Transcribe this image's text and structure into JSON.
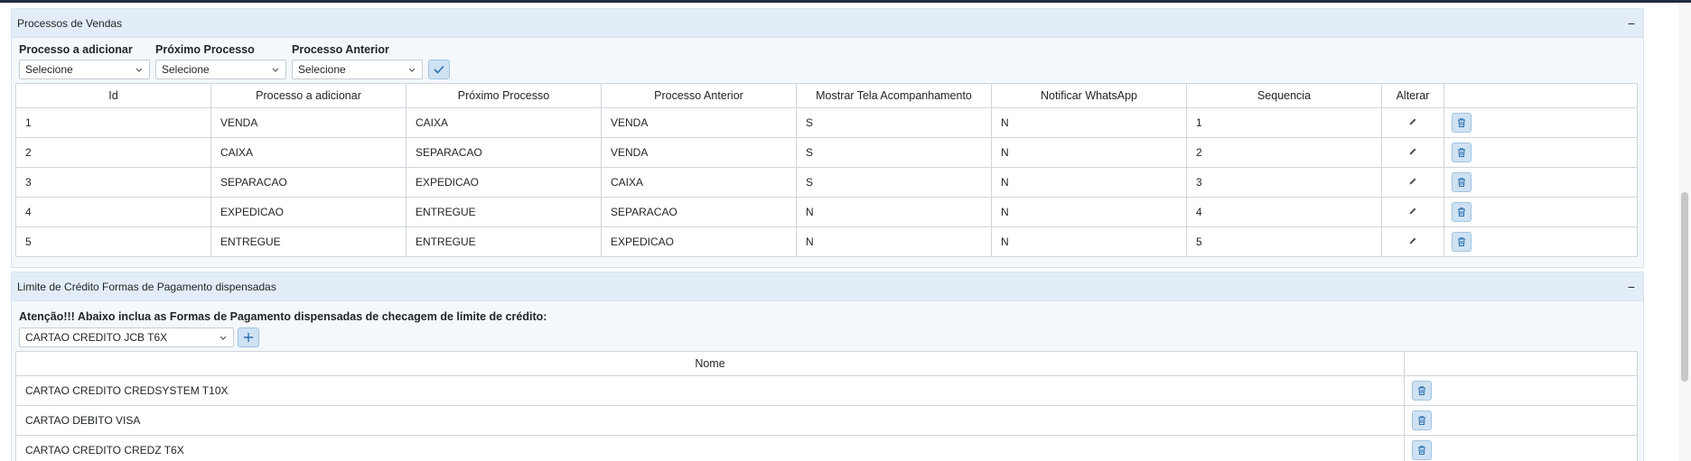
{
  "sales_panel": {
    "title": "Processos de Vendas",
    "collapse": "−",
    "filters": [
      {
        "label": "Processo a adicionar",
        "value": "Selecione"
      },
      {
        "label": "Próximo Processo",
        "value": "Selecione"
      },
      {
        "label": "Processo Anterior",
        "value": "Selecione"
      }
    ],
    "columns": [
      "Id",
      "Processo a adicionar",
      "Próximo Processo",
      "Processo Anterior",
      "Mostrar Tela Acompanhamento",
      "Notificar WhatsApp",
      "Sequencia",
      "Alterar",
      ""
    ],
    "rows": [
      {
        "id": "1",
        "add": "VENDA",
        "next": "CAIXA",
        "prev": "VENDA",
        "show": "S",
        "notify": "N",
        "seq": "1"
      },
      {
        "id": "2",
        "add": "CAIXA",
        "next": "SEPARACAO",
        "prev": "VENDA",
        "show": "S",
        "notify": "N",
        "seq": "2"
      },
      {
        "id": "3",
        "add": "SEPARACAO",
        "next": "EXPEDICAO",
        "prev": "CAIXA",
        "show": "S",
        "notify": "N",
        "seq": "3"
      },
      {
        "id": "4",
        "add": "EXPEDICAO",
        "next": "ENTREGUE",
        "prev": "SEPARACAO",
        "show": "N",
        "notify": "N",
        "seq": "4"
      },
      {
        "id": "5",
        "add": "ENTREGUE",
        "next": "ENTREGUE",
        "prev": "EXPEDICAO",
        "show": "N",
        "notify": "N",
        "seq": "5"
      }
    ]
  },
  "credit_panel": {
    "title": "Limite de Crédito Formas de Pagamento dispensadas",
    "collapse": "−",
    "warning": "Atenção!!! Abaixo inclua as Formas de Pagamento dispensadas de checagem de limite de crédito:",
    "select_value": "CARTAO CREDITO JCB T6X",
    "columns": [
      "Nome",
      ""
    ],
    "rows": [
      {
        "name": "CARTAO CREDITO CREDSYSTEM T10X"
      },
      {
        "name": "CARTAO DEBITO VISA"
      },
      {
        "name": "CARTAO CREDITO CREDZ T6X"
      }
    ]
  },
  "icons": {
    "confirm": "check-icon",
    "add": "plus-icon",
    "edit": "pencil-icon",
    "delete": "trash-icon",
    "dropdown": "chevron-down-icon"
  },
  "colors": {
    "panel_header": "#e3edf7",
    "button_bg": "#cfe2f3",
    "button_icon": "#2a6fb0"
  }
}
